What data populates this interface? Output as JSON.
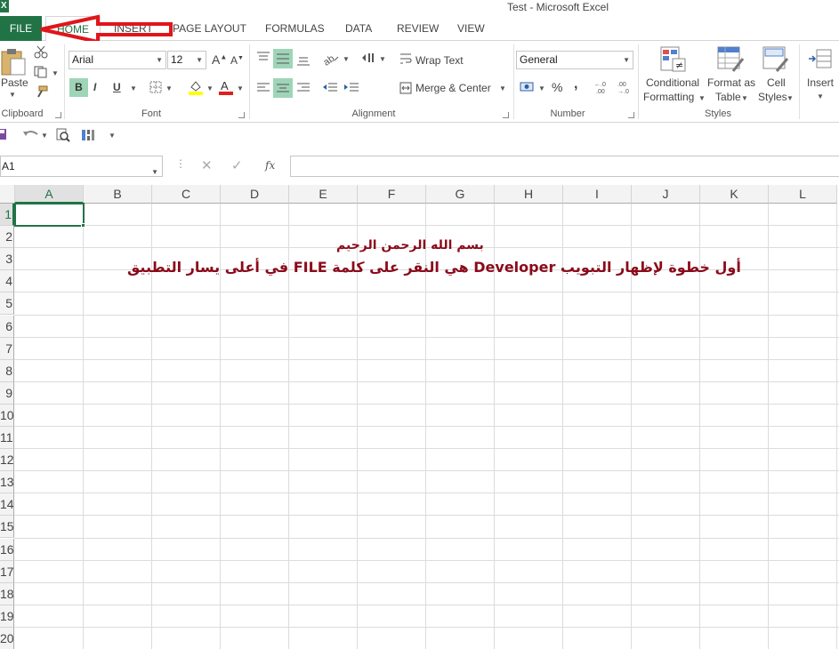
{
  "window": {
    "title": "Test - Microsoft Excel",
    "app_logo": "X"
  },
  "tabs": [
    {
      "label": "FILE"
    },
    {
      "label": "HOME"
    },
    {
      "label": "INSERT"
    },
    {
      "label": "PAGE LAYOUT"
    },
    {
      "label": "FORMULAS"
    },
    {
      "label": "DATA"
    },
    {
      "label": "REVIEW"
    },
    {
      "label": "VIEW"
    }
  ],
  "ribbon": {
    "clipboard": {
      "paste_label": "Paste",
      "group_label": "Clipboard"
    },
    "font": {
      "name": "Arial",
      "size": "12",
      "bold": "B",
      "italic": "I",
      "underline": "U",
      "group_label": "Font"
    },
    "alignment": {
      "wrap_text": "Wrap Text",
      "merge_center": "Merge & Center",
      "group_label": "Alignment"
    },
    "number": {
      "format": "General",
      "percent": "%",
      "comma": ",",
      "group_label": "Number"
    },
    "styles": {
      "conditional_1": "Conditional",
      "conditional_2": "Formatting",
      "format_as_1": "Format as",
      "format_as_2": "Table",
      "cell_styles_1": "Cell",
      "cell_styles_2": "Styles",
      "group_label": "Styles"
    },
    "cells": {
      "insert": "Insert"
    }
  },
  "formula_bar": {
    "name_box": "A1",
    "fx": "fx",
    "value": ""
  },
  "grid": {
    "columns": [
      "A",
      "B",
      "C",
      "D",
      "E",
      "F",
      "G",
      "H",
      "I",
      "J",
      "K",
      "L"
    ],
    "rows": [
      "1",
      "2",
      "3",
      "4",
      "5",
      "6",
      "7",
      "8",
      "9",
      "10",
      "11",
      "12",
      "13",
      "14",
      "15",
      "16",
      "17",
      "18",
      "19",
      "20"
    ],
    "selected_cell": "A1"
  },
  "annotation": {
    "line1": "بسم الله الرحمن الرحيم",
    "line2": "أول خطوة لإظهار التبويب Developer هي النقر على كلمة FILE في أعلى يسار التطبيق"
  },
  "colors": {
    "accent": "#217346",
    "arrow": "#e0151b",
    "annotation_text": "#8b0a1a"
  }
}
